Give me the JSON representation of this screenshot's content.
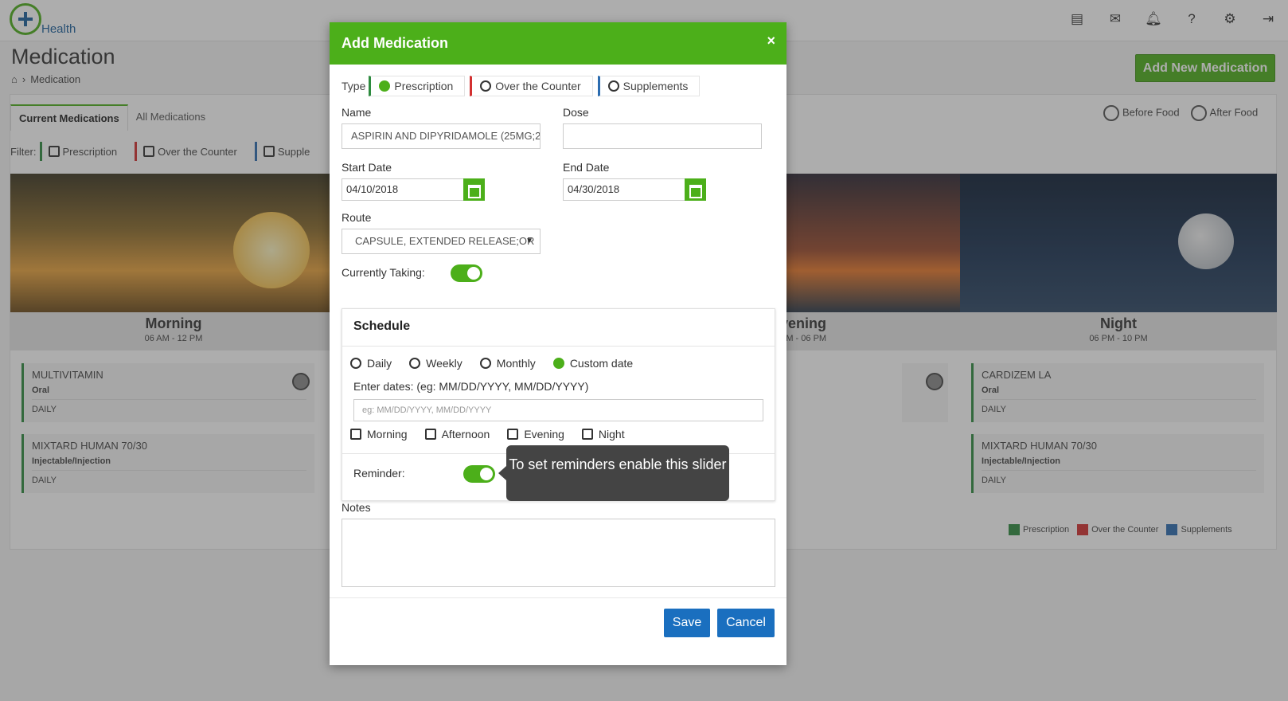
{
  "app": {
    "logo_text": "Health"
  },
  "header": {
    "icons": [
      "newspaper-icon",
      "mail-icon",
      "bell-icon",
      "help-icon",
      "gear-icon",
      "logout-icon"
    ]
  },
  "page": {
    "title": "Medication",
    "breadcrumb": "Medication",
    "add_button": "Add New Medication"
  },
  "tabs": [
    "Current Medications",
    "All Medications"
  ],
  "food_legend": {
    "before": "Before Food",
    "after": "After Food"
  },
  "filter": {
    "label": "Filter:",
    "options": [
      "Prescription",
      "Over the Counter",
      "Supple"
    ]
  },
  "periods": [
    {
      "name": "Morning",
      "time": "06 AM - 12 PM"
    },
    {
      "name": "vening",
      "time": "PM - 06 PM"
    },
    {
      "name": "Night",
      "time": "06 PM - 10 PM"
    }
  ],
  "morning_meds": [
    {
      "name": "MULTIVITAMIN",
      "route": "Oral",
      "freq": "DAILY"
    },
    {
      "name": "MIXTARD HUMAN 70/30",
      "route": "Injectable/Injection",
      "freq": "DAILY"
    }
  ],
  "night_meds": [
    {
      "name": "CARDIZEM LA",
      "route": "Oral",
      "freq": "DAILY"
    },
    {
      "name": "MIXTARD HUMAN 70/30",
      "route": "Injectable/Injection",
      "freq": "DAILY"
    }
  ],
  "legend_bottom": [
    "Prescription",
    "Over the Counter",
    "Supplements"
  ],
  "colors": {
    "prescription": "#2e8b3f",
    "otc": "#d33030",
    "supplements": "#2b6cb0",
    "accent": "#4caf1a",
    "button": "#1a6fbf"
  },
  "modal": {
    "title": "Add Medication",
    "close": "×",
    "type_label": "Type",
    "type_options": [
      "Prescription",
      "Over the Counter",
      "Supplements"
    ],
    "type_selected": "Prescription",
    "name_label": "Name",
    "name_value": "ASPIRIN AND DIPYRIDAMOLE (25MG;2",
    "dose_label": "Dose",
    "dose_value": "",
    "start_label": "Start Date",
    "start_value": "04/10/2018",
    "end_label": "End Date",
    "end_value": "04/30/2018",
    "route_label": "Route",
    "route_value": "CAPSULE, EXTENDED RELEASE;OR",
    "taking_label": "Currently Taking:",
    "schedule_title": "Schedule",
    "freq_options": [
      "Daily",
      "Weekly",
      "Monthly",
      "Custom date"
    ],
    "freq_selected": "Custom date",
    "dates_label": "Enter dates: (eg: MM/DD/YYYY, MM/DD/YYYY)",
    "dates_placeholder": "eg: MM/DD/YYYY, MM/DD/YYYY",
    "time_options": [
      "Morning",
      "Afternoon",
      "Evening",
      "Night"
    ],
    "reminder_label": "Reminder:",
    "tooltip": "To set reminders enable this slider",
    "notes_label": "Notes",
    "save": "Save",
    "cancel": "Cancel"
  }
}
